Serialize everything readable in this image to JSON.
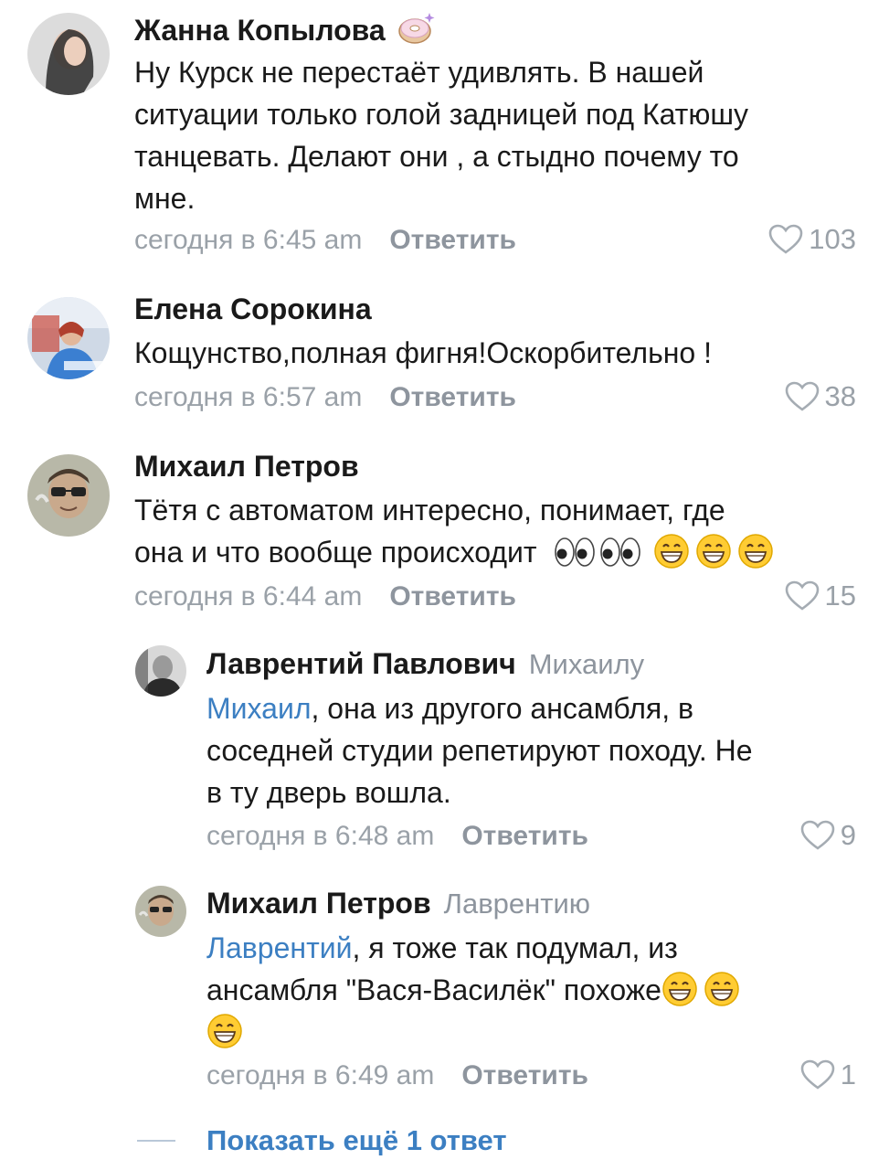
{
  "comments": [
    {
      "author": "Жанна Копылова",
      "text_lines": [
        "Ну Курск не перестаёт удивлять. В нашей",
        "ситуации только голой задницей под Катюшу",
        "танцевать. Делают они , а стыдно почему то",
        "мне."
      ],
      "time": "сегодня в 6:45 am",
      "reply_label": "Ответить",
      "likes": "103"
    },
    {
      "author": "Елена Сорокина",
      "text_lines": [
        "Кощунство,полная фигня!Оскорбительно  !"
      ],
      "time": "сегодня в 6:57 am",
      "reply_label": "Ответить",
      "likes": "38"
    },
    {
      "author": "Михаил Петров",
      "text_lines": [
        "Тётя с автоматом интересно, понимает, где",
        "она и что вообще происходит"
      ],
      "time": "сегодня в 6:44 am",
      "reply_label": "Ответить",
      "likes": "15"
    }
  ],
  "replies": [
    {
      "author": "Лаврентий Павлович",
      "reply_to": "Михаилу",
      "mention": "Михаил",
      "text_first": ", она из другого ансамбля, в",
      "text_lines": [
        "соседней студии репетируют походу. Не",
        "в ту дверь вошла."
      ],
      "time": "сегодня в 6:48 am",
      "reply_label": "Ответить",
      "likes": "9"
    },
    {
      "author": "Михаил Петров",
      "reply_to": "Лаврентию",
      "mention": "Лаврентий",
      "text_first": ", я тоже так подумал, из",
      "text_second": "ансамбля \"Вася-Василёк\" похоже",
      "time": "сегодня в 6:49 am",
      "reply_label": "Ответить",
      "likes": "1"
    }
  ],
  "show_more": "Показать ещё 1 ответ",
  "colors": {
    "accent": "#3c7fc2",
    "meta": "#9aa1a8",
    "text": "#1a1a1a"
  }
}
